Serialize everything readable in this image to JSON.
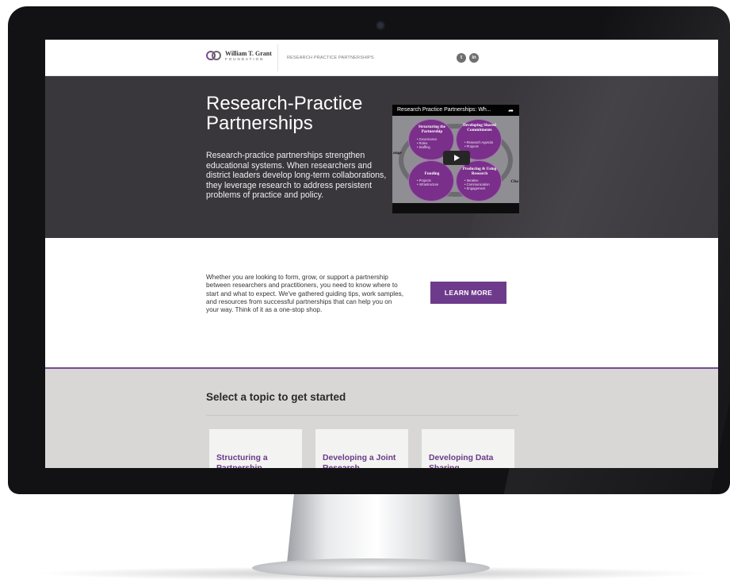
{
  "header": {
    "logo_name": "William T. Grant",
    "logo_sub": "FOUNDATION",
    "nav_label": "RESEARCH PRACTICE PARTNERSHIPS",
    "social": [
      {
        "icon": "twitter-icon",
        "glyph": "t"
      },
      {
        "icon": "linkedin-icon",
        "glyph": "in"
      }
    ]
  },
  "hero": {
    "title": "Research-Practice Partnerships",
    "description": "Research-practice partnerships strengthen educational systems. When researchers and district leaders develop long-term collaborations, they leverage research to address persistent problems of practice and policy.",
    "video": {
      "title": "Research Practice Partnerships: Wh...",
      "quadrants": [
        {
          "title": "Structuring the Partnership",
          "bullets": "• Governance\n• Roles\n• Staffing"
        },
        {
          "title": "Developing Shared Commitments",
          "bullets": "• Research Agenda\n• Projects"
        },
        {
          "title": "Funding",
          "bullets": "• Projects\n• Infrastructure"
        },
        {
          "title": "Producing & Using Research",
          "bullets": "• Iterative\n• Communication\n• Engagement"
        }
      ],
      "side_left": "ange",
      "side_right": "Cha"
    }
  },
  "intro": {
    "text": "Whether you are looking to form, grow, or support a partnership between researchers and practitioners, you need to know where to start and what to expect. We've gathered guiding tips, work samples, and resources from successful partnerships that can help you on your way. Think of it as a one-stop shop.",
    "button": "LEARN MORE"
  },
  "topics": {
    "title": "Select a topic to get started",
    "cards": [
      {
        "label": "Structuring a Partnership"
      },
      {
        "label": "Developing a Joint Research"
      },
      {
        "label": "Developing Data Sharing"
      }
    ]
  },
  "colors": {
    "accent": "#6e3b8c",
    "hero_bg": "#3a373c",
    "topics_bg": "#d8d7d5"
  }
}
